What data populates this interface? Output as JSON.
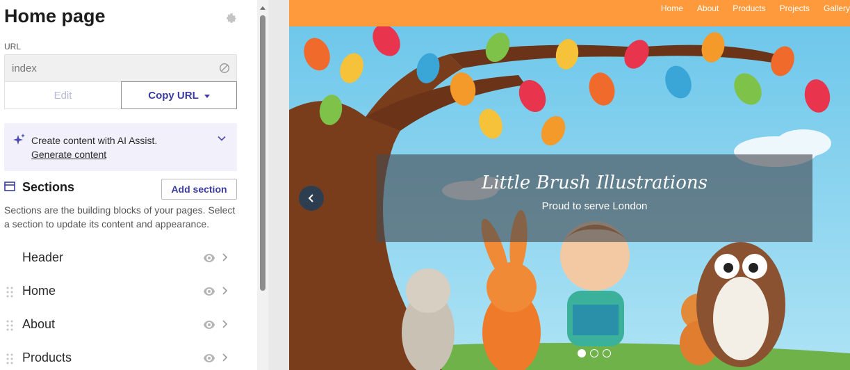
{
  "editor": {
    "title": "Home page",
    "url_label": "URL",
    "url_value": "index",
    "edit_label": "Edit",
    "copy_url_label": "Copy URL",
    "ai": {
      "text": "Create content with AI Assist.",
      "link": "Generate content"
    },
    "sections": {
      "title": "Sections",
      "add_label": "Add section",
      "description": "Sections are the building blocks of your pages. Select a section to update its content and appearance.",
      "items": [
        {
          "label": "Header"
        },
        {
          "label": "Home"
        },
        {
          "label": "About"
        },
        {
          "label": "Products"
        }
      ]
    }
  },
  "site": {
    "nav": [
      "Home",
      "About",
      "Products",
      "Projects",
      "Gallery"
    ],
    "hero_title": "Little Brush Illustrations",
    "hero_subtitle": "Proud to serve London",
    "slide_count": 3,
    "active_slide": 1
  },
  "colors": {
    "accent": "#3b3ba0",
    "nav_bg": "#ff9a3c",
    "sky": "#8fd3ef"
  }
}
